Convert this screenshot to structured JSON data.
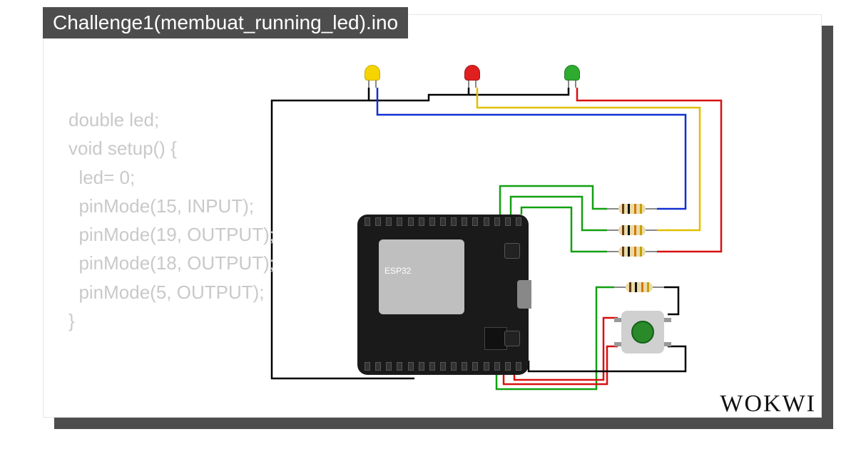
{
  "title": "Challenge1(membuat_running_led).ino",
  "code": {
    "line1": "double led;",
    "line2": "void setup() {",
    "line3": "  led= 0;",
    "line4": "  pinMode(15, INPUT);",
    "line5": "  pinMode(19, OUTPUT);",
    "line6": "  pinMode(18, OUTPUT);",
    "line7": "  pinMode(5, OUTPUT);",
    "line8": "}"
  },
  "board": {
    "label": "ESP32"
  },
  "components": {
    "leds": [
      {
        "name": "yellow-led",
        "color": "#f5d400"
      },
      {
        "name": "red-led",
        "color": "#e02020"
      },
      {
        "name": "green-led",
        "color": "#2fab2f"
      }
    ],
    "resistors": 4,
    "pushbutton": {
      "color": "#2a8a2a"
    }
  },
  "wire_colors": {
    "black": "#000000",
    "green": "#11a011",
    "red": "#d81010",
    "blue": "#1030d0",
    "yellow": "#e0c000"
  },
  "logo": "WOKWI"
}
